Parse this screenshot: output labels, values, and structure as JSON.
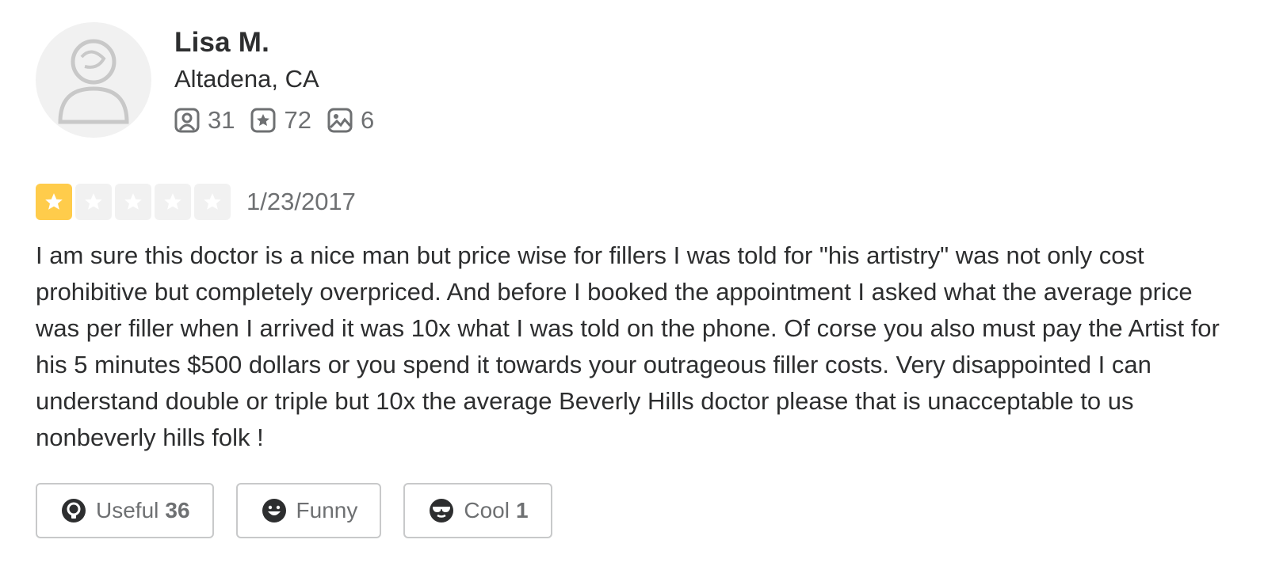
{
  "user": {
    "name": "Lisa M.",
    "location": "Altadena, CA",
    "stats": {
      "friends": "31",
      "reviews": "72",
      "photos": "6"
    }
  },
  "review": {
    "rating": 1,
    "rating_max": 5,
    "date": "1/23/2017",
    "text": "I am sure this doctor is a nice man but price wise for fillers I was told for \"his artistry\" was not only cost prohibitive but completely overpriced. And before I booked the appointment I asked what the average price was per filler when I arrived it was 10x what I was told on the phone. Of corse you also must pay the Artist for his 5 minutes $500 dollars or you spend it towards your outrageous filler costs. Very disappointed I can understand double or triple but 10x the average Beverly Hills doctor please that is unacceptable to us nonbeverly hills folk !"
  },
  "reactions": {
    "useful": {
      "label": "Useful",
      "count": "36",
      "icon": "lightbulb-icon"
    },
    "funny": {
      "label": "Funny",
      "count": "",
      "icon": "smile-icon"
    },
    "cool": {
      "label": "Cool",
      "count": "1",
      "icon": "sunglasses-icon"
    }
  },
  "colors": {
    "star_filled": "#ffcc4b",
    "star_empty": "#f1f1f1",
    "text_primary": "#2d2e2f",
    "text_secondary": "#6e7072",
    "border": "#c8c9ca"
  }
}
